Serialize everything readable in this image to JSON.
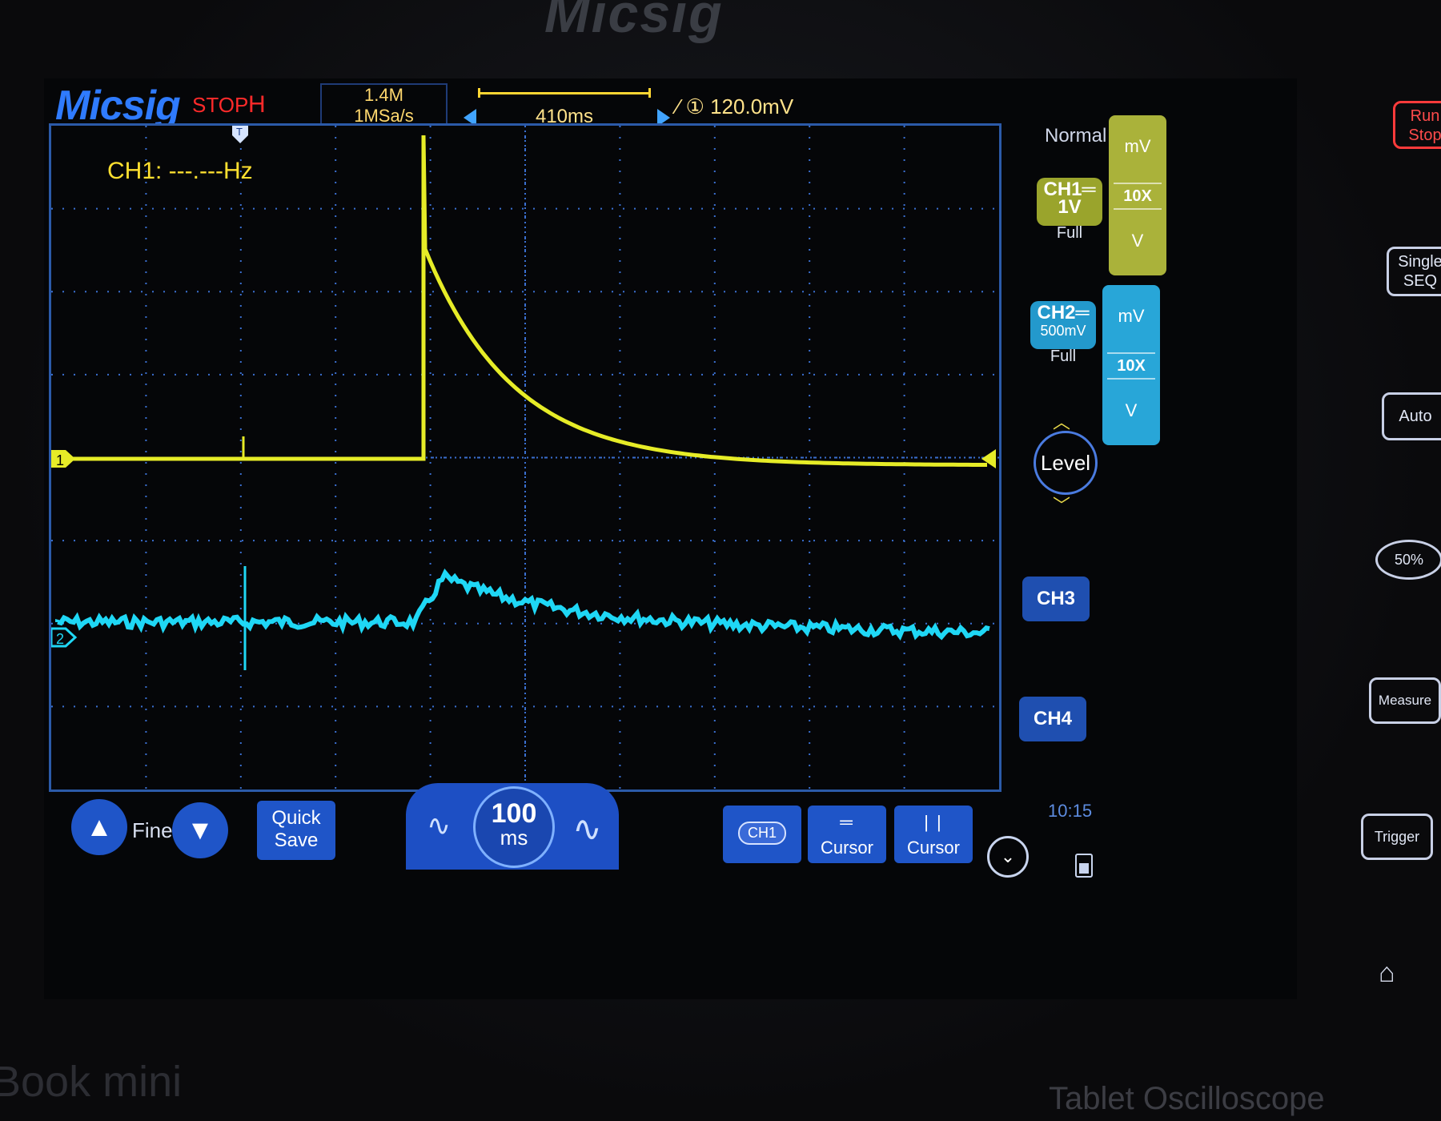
{
  "device": {
    "top_brand": "Micsig",
    "bottom_left_brand": "Book mini",
    "bottom_right_brand": "Tablet Oscilloscope"
  },
  "status": {
    "logo": "Micsig",
    "run_state": "STOP",
    "trigger_mode_letter": "H",
    "memory_depth": "1.4M",
    "sample_rate": "1MSa/s",
    "time_offset": "410ms",
    "trigger_info": "∕ ① 120.0mV"
  },
  "measurement": {
    "ch1_frequency": "CH1: ---.---Hz"
  },
  "acquisition_mode": "Normal",
  "channels": {
    "ch1": {
      "label": "CH1═",
      "scale": "1V",
      "bandwidth": "Full",
      "unit_top": "mV",
      "probe": "10X",
      "unit_bottom": "V",
      "color": "#e6ec27"
    },
    "ch2": {
      "label": "CH2═",
      "scale": "500mV",
      "bandwidth": "Full",
      "unit_top": "mV",
      "probe": "10X",
      "unit_bottom": "V",
      "color": "#1fd7f5"
    },
    "ch3": {
      "label": "CH3"
    },
    "ch4": {
      "label": "CH4"
    }
  },
  "markers": {
    "ch1": "1",
    "ch2": "2",
    "trigger": "T"
  },
  "level": {
    "label": "Level",
    "up_icon": "chevron-up",
    "down_icon": "chevron-down"
  },
  "toolbar": {
    "fine_label": "Fine",
    "quick_save_line1": "Quick",
    "quick_save_line2": "Save",
    "timebase_value": "100",
    "timebase_unit": "ms",
    "ch1_select_label": "CH1",
    "hcursor_label": "Cursor",
    "vcursor_label": "Cursor",
    "clock": "10:15"
  },
  "hardware_buttons": {
    "run_stop_line1": "Run",
    "run_stop_line2": "Stop",
    "single_line1": "Single",
    "single_line2": "SEQ",
    "auto": "Auto",
    "half": "50%",
    "measure": "Measure",
    "trigger": "Trigger"
  }
}
